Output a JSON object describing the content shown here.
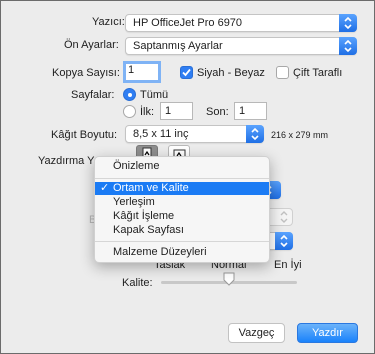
{
  "printer": {
    "label": "Yazıcı:",
    "value": "HP OfficeJet Pro 6970"
  },
  "presets": {
    "label": "Ön Ayarlar:",
    "value": "Saptanmış Ayarlar"
  },
  "copies": {
    "label": "Kopya Sayısı:",
    "value": "1",
    "bw_label": "Siyah - Beyaz",
    "bw_checked": true,
    "duplex_label": "Çift Taraflı",
    "duplex_checked": false
  },
  "pages": {
    "label": "Sayfalar:",
    "all_label": "Tümü",
    "from_label": "İlk:",
    "from_value": "1",
    "to_label": "Son:",
    "to_value": "1"
  },
  "paper_size": {
    "label": "Kâğıt Boyutu:",
    "value": "8,5 x 11 inç",
    "dimensions": "216 x 279 mm"
  },
  "orientation": {
    "label": "Yazdırma Y"
  },
  "background": {
    "hidden_label": "Be",
    "quality_low": "Taslak",
    "quality_normal": "Normal",
    "quality_best": "En İyi",
    "quality_label": "Kalite:",
    "quality_level": 0.5
  },
  "menu": {
    "items": [
      {
        "label": "Önizleme"
      },
      {
        "label": "Ortam ve Kalite",
        "selected": true
      },
      {
        "label": "Yerleşim"
      },
      {
        "label": "Kâğıt İşleme"
      },
      {
        "label": "Kapak Sayfası"
      },
      {
        "label": "Malzeme Düzeyleri"
      }
    ],
    "check_glyph": "✓"
  },
  "buttons": {
    "cancel": "Vazgeç",
    "print": "Yazdır"
  },
  "colors": {
    "accent": "#1b7bf4",
    "checked": "#2f7ef3"
  }
}
